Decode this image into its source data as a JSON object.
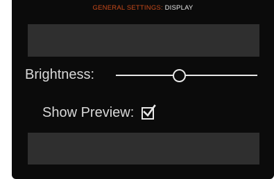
{
  "header": {
    "section": "GENERAL SETTINGS:",
    "page": "DISPLAY"
  },
  "settings": {
    "brightness": {
      "label": "Brightness:",
      "value": 0.45
    },
    "show_preview": {
      "label": "Show Preview:",
      "checked": true
    }
  },
  "colors": {
    "section_accent": "#c84a1a",
    "text": "#d8d8d8",
    "background": "#0b0b0b",
    "panel": "#2f2f2f"
  },
  "icons": {
    "checkbox": "checkmark-icon"
  }
}
